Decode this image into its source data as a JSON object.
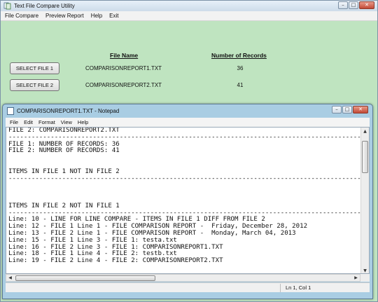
{
  "main_window": {
    "title": "Text File Compare Utility",
    "menu": [
      "File Compare",
      "Preview Report",
      "Help",
      "Exit"
    ],
    "header_file_name": "File Name",
    "header_num_records": "Number of Records",
    "rows": [
      {
        "button": "SELECT FILE 1",
        "file_name": "COMPARISONREPORT1.TXT",
        "records": "36"
      },
      {
        "button": "SELECT FILE 2",
        "file_name": "COMPARISONREPORT2.TXT",
        "records": "41"
      }
    ]
  },
  "notepad": {
    "title": "COMPARISONREPORT1.TXT - Notepad",
    "menu": [
      "File",
      "Edit",
      "Format",
      "View",
      "Help"
    ],
    "lines": [
      "FILE 2: COMPARISONREPORT2.TXT",
      "------------------------------------------------------------------------------------------------------------------------------------------",
      "FILE 1: NUMBER OF RECORDS: 36",
      "FILE 2: NUMBER OF RECORDS: 41",
      "",
      "",
      "ITEMS IN FILE 1 NOT IN FILE 2",
      "------------------------------------------------------------------------------------------------------------------------------------------",
      "",
      "",
      "",
      "ITEMS IN FILE 2 NOT IN FILE 1",
      "------------------------------------------------------------------------------------------------------------------------------------------",
      "Line: 10 - LINE FOR LINE COMPARE - ITEMS IN FILE 1 DIFF FROM FILE 2",
      "Line: 12 - FILE 1 Line 1 - FILE COMPARISON REPORT -  Friday, December 28, 2012",
      "Line: 13 - FILE 2 Line 1 - FILE COMPARISON REPORT -  Monday, March 04, 2013",
      "Line: 15 - FILE 1 Line 3 - FILE 1: testa.txt",
      "Line: 16 - FILE 2 Line 3 - FILE 1: COMPARISONREPORT1.TXT",
      "Line: 18 - FILE 1 Line 4 - FILE 2: testb.txt",
      "Line: 19 - FILE 2 Line 4 - FILE 2: COMPARISONREPORT2.TXT"
    ],
    "status_position": "Ln 1, Col 1"
  }
}
